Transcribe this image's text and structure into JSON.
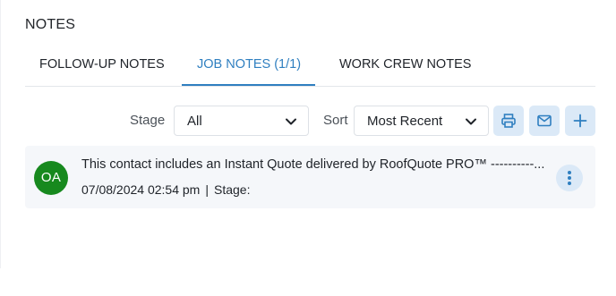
{
  "section": {
    "title": "NOTES"
  },
  "tabs": [
    {
      "label": "FOLLOW-UP NOTES",
      "active": false
    },
    {
      "label": "JOB NOTES (1/1)",
      "active": true
    },
    {
      "label": "WORK CREW NOTES",
      "active": false
    }
  ],
  "filters": {
    "stage_label": "Stage",
    "stage_value": "All",
    "sort_label": "Sort",
    "sort_value": "Most Recent"
  },
  "actions": [
    {
      "icon": "print-icon"
    },
    {
      "icon": "mail-icon"
    },
    {
      "icon": "plus-icon"
    }
  ],
  "notes": [
    {
      "initials": "OA",
      "text": "This contact includes an Instant Quote delivered by RoofQuote PRO™ ----------...",
      "datetime": "07/08/2024 02:54 pm",
      "separator": "|",
      "stage_label": "Stage:"
    }
  ],
  "colors": {
    "accent": "#2f7fc0",
    "button_bg": "#dbe9f7",
    "avatar_bg": "#17891e",
    "card_bg": "#f5f7fa"
  }
}
